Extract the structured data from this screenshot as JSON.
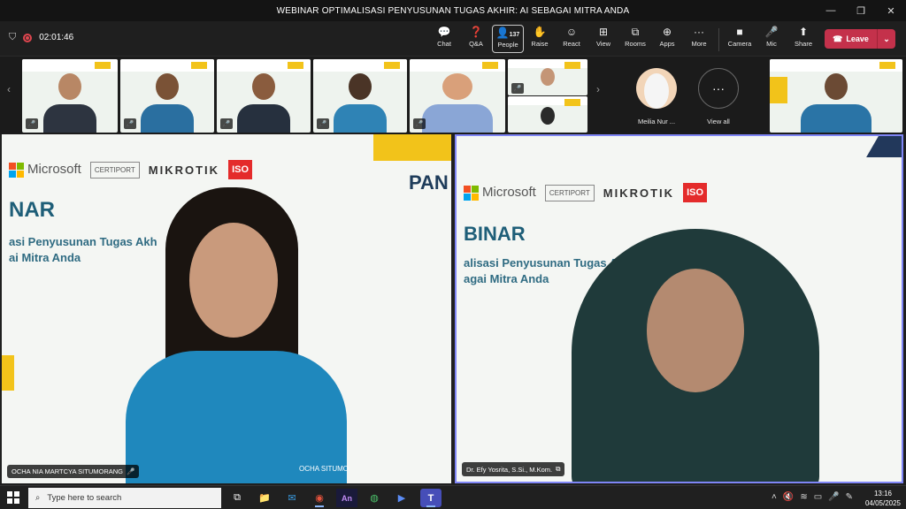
{
  "window": {
    "title": "WEBINAR OPTIMALISASI PENYUSUNAN TUGAS AKHIR: AI SEBAGAI MITRA ANDA",
    "min": "—",
    "max": "❐",
    "close": "✕"
  },
  "meeting": {
    "timer": "02:01:46"
  },
  "toolbar": [
    {
      "label": "Chat",
      "icon": "💬"
    },
    {
      "label": "Q&A",
      "icon": "❓"
    },
    {
      "label": "People",
      "icon": "👤",
      "badge": "137"
    },
    {
      "label": "Raise",
      "icon": "✋"
    },
    {
      "label": "React",
      "icon": "☺"
    },
    {
      "label": "View",
      "icon": "⊞"
    },
    {
      "label": "Rooms",
      "icon": "⧉"
    },
    {
      "label": "Apps",
      "icon": "⊕"
    },
    {
      "label": "More",
      "icon": "···"
    },
    {
      "label": "Camera",
      "icon": "■"
    },
    {
      "label": "Mic",
      "icon": "🎤"
    },
    {
      "label": "Share",
      "icon": "⬆"
    }
  ],
  "leave": {
    "label": "Leave",
    "icon": "☎",
    "caret": "⌄"
  },
  "gallery": {
    "prev": "‹",
    "next": "›",
    "avatar_name": "Meilia Nur ...",
    "view_all": "View all",
    "view_all_icon": "···"
  },
  "stage": {
    "left": {
      "name": "OCHA NIA MARTCYA SITUMORANG",
      "slide_title": "NAR",
      "slide_line1": "asi Penyusunan Tugas Akh",
      "slide_line2": "ai Mitra Anda",
      "brand1": "Microsoft",
      "brand2": "CERTIPORT",
      "brand3": "MIKROTIK",
      "brand4": "ISO",
      "corner_text": "PAN",
      "shirt_text": "OCHA SITUMO"
    },
    "right": {
      "name": "Dr. Efy Yosrita, S.Si., M.Kom.",
      "slide_title": "BINAR",
      "slide_line1": "alisasi Penyusunan Tugas A",
      "slide_line2": "agai Mitra Anda",
      "brand1": "Microsoft",
      "brand2": "CERTIPORT",
      "brand3": "MIKROTIK",
      "brand4": "ISO"
    }
  },
  "taskbar": {
    "search_placeholder": "Type here to search",
    "time": "13:16",
    "date": "04/05/2025",
    "apps": [
      "⧉",
      "📁",
      "✉",
      "◉",
      "An",
      "◍",
      "▶",
      "T"
    ]
  }
}
